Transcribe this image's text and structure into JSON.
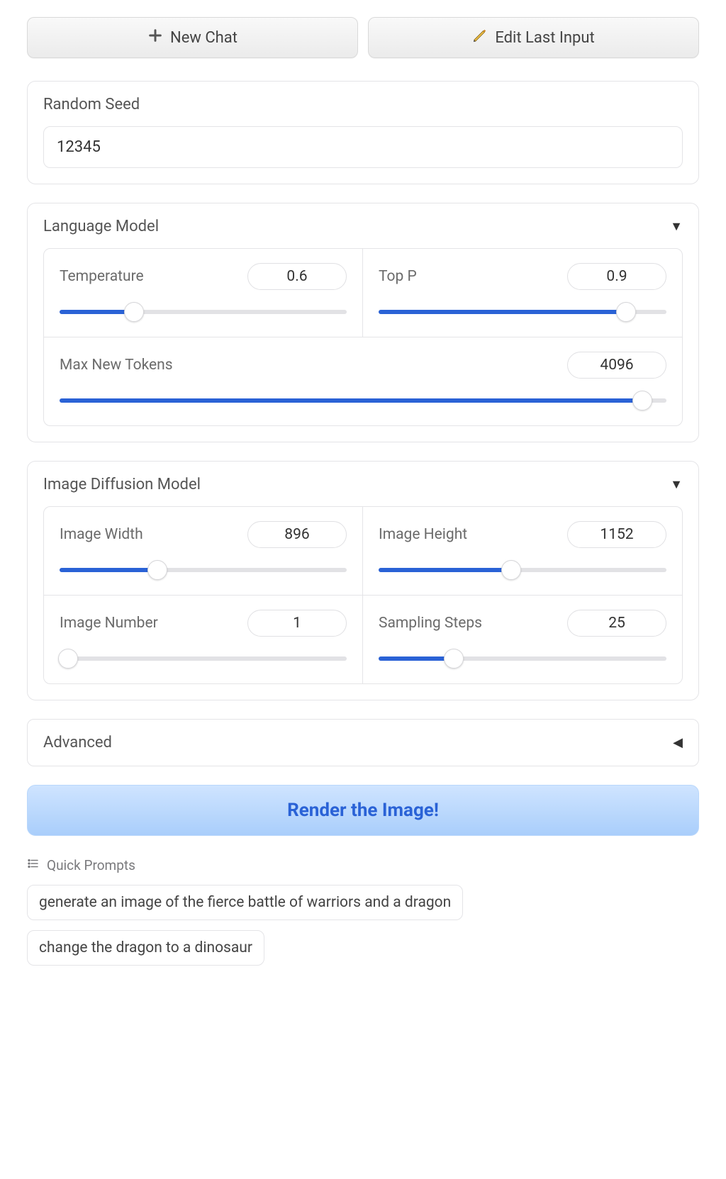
{
  "topButtons": {
    "newChat": "New Chat",
    "editLast": "Edit Last Input"
  },
  "seedPanel": {
    "title": "Random Seed",
    "value": "12345"
  },
  "lmPanel": {
    "title": "Language Model",
    "temperature": {
      "label": "Temperature",
      "value": "0.6",
      "pct": 26
    },
    "topP": {
      "label": "Top P",
      "value": "0.9",
      "pct": 86
    },
    "maxTokens": {
      "label": "Max New Tokens",
      "value": "4096",
      "pct": 96
    }
  },
  "imgPanel": {
    "title": "Image Diffusion Model",
    "width": {
      "label": "Image Width",
      "value": "896",
      "pct": 34
    },
    "height": {
      "label": "Image Height",
      "value": "1152",
      "pct": 46
    },
    "number": {
      "label": "Image Number",
      "value": "1",
      "pct": 3
    },
    "steps": {
      "label": "Sampling Steps",
      "value": "25",
      "pct": 26
    }
  },
  "advanced": {
    "title": "Advanced"
  },
  "renderBtn": "Render the Image!",
  "quickPrompts": {
    "title": "Quick Prompts",
    "items": [
      "generate an image of the fierce battle of warriors and a dragon",
      "change the dragon to a dinosaur"
    ]
  }
}
